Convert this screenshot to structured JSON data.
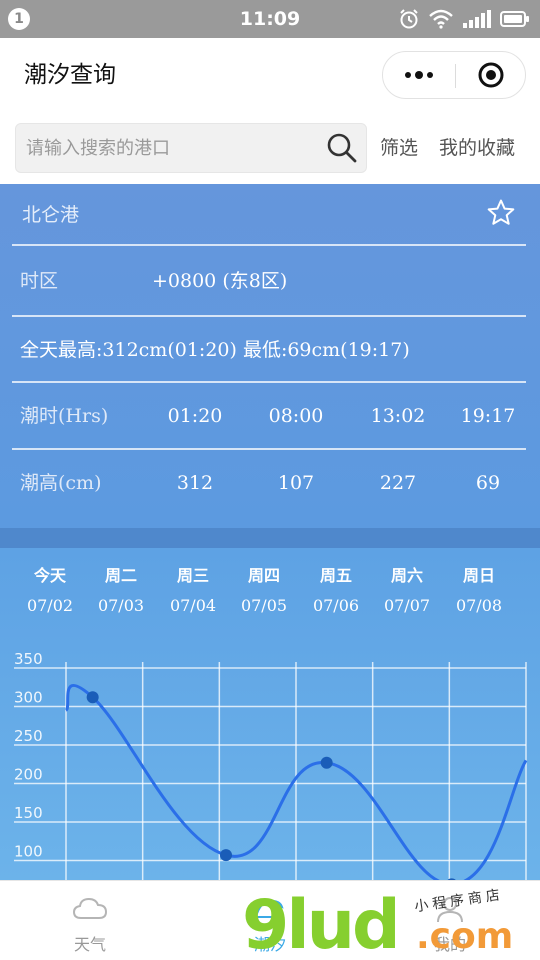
{
  "status_bar": {
    "badge": "1",
    "time": "11:09"
  },
  "nav": {
    "title": "潮汐查询"
  },
  "search": {
    "placeholder": "请输入搜索的港口",
    "filter_label": "筛选",
    "favorites_label": "我的收藏"
  },
  "port": {
    "name": "北仑港",
    "timezone_label": "时区",
    "timezone_value": "+0800 (东8区)",
    "summary": "全天最高:312cm(01:20) 最低:69cm(19:17)",
    "tide_time_label": "潮时(Hrs)",
    "tide_height_label": "潮高(cm)",
    "tide_times": [
      "01:20",
      "08:00",
      "13:02",
      "19:17"
    ],
    "tide_heights": [
      "312",
      "107",
      "227",
      "69"
    ]
  },
  "week": [
    {
      "name": "今天",
      "date": "07/02"
    },
    {
      "name": "周二",
      "date": "07/03"
    },
    {
      "name": "周三",
      "date": "07/04"
    },
    {
      "name": "周四",
      "date": "07/05"
    },
    {
      "name": "周五",
      "date": "07/06"
    },
    {
      "name": "周六",
      "date": "07/07"
    },
    {
      "name": "周日",
      "date": "07/08"
    }
  ],
  "chart_data": {
    "type": "line",
    "x": [
      "00:00",
      "01:20",
      "08:00",
      "13:02",
      "19:17",
      "23:00"
    ],
    "values": [
      295,
      312,
      107,
      227,
      69,
      230
    ],
    "markers": [
      {
        "x": "01:20",
        "y": 312
      },
      {
        "x": "08:00",
        "y": 107
      },
      {
        "x": "13:02",
        "y": 227
      },
      {
        "x": "19:17",
        "y": 69
      }
    ],
    "yticks": [
      100,
      150,
      200,
      250,
      300,
      350
    ],
    "ylim": [
      50,
      350
    ],
    "grid": true,
    "line_color": "#2b6fe8"
  },
  "tabs": [
    {
      "label": "天气",
      "icon": "cloud-icon"
    },
    {
      "label": "潮汐",
      "icon": "wave-icon"
    },
    {
      "label": "",
      "icon": "user-icon"
    },
    {
      "label": "我的",
      "icon": "user-icon"
    }
  ],
  "watermark": {
    "text": "9lud",
    "domain": ".com",
    "tagline": "小程序商店"
  }
}
